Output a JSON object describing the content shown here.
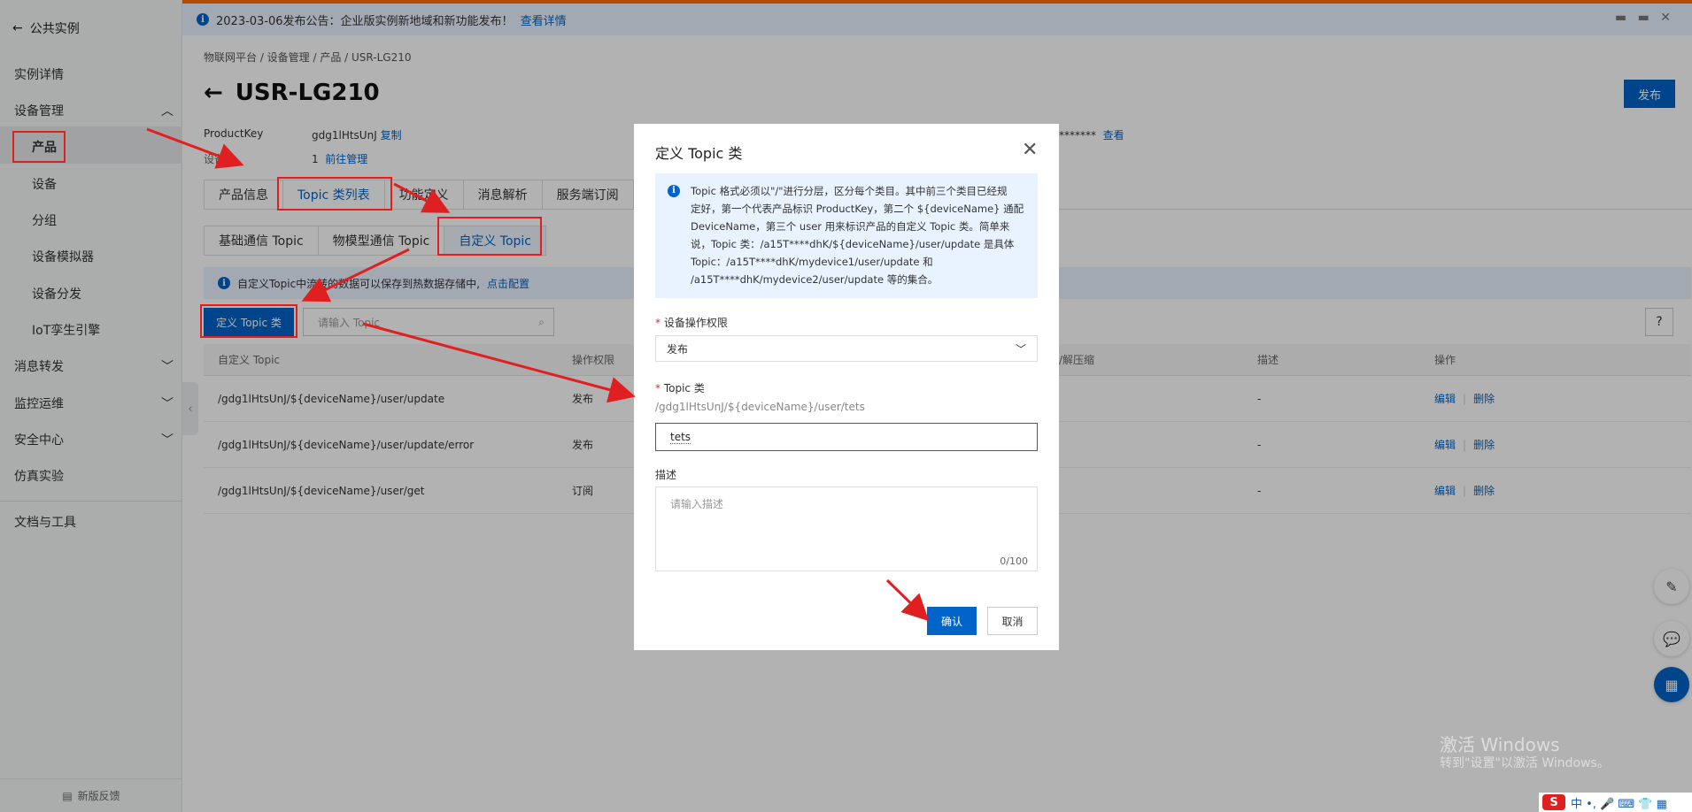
{
  "banner": {
    "text": "2023-03-06发布公告：企业版实例新地域和新功能发布！",
    "link": "查看详情",
    "controls": "▬ ▬ ✕"
  },
  "sidebar": {
    "back_label": "公共实例",
    "items": [
      {
        "label": "实例详情"
      },
      {
        "label": "设备管理"
      },
      {
        "label": "产品"
      },
      {
        "label": "设备"
      },
      {
        "label": "分组"
      },
      {
        "label": "设备模拟器"
      },
      {
        "label": "设备分发"
      },
      {
        "label": "IoT孪生引擎"
      },
      {
        "label": "消息转发"
      },
      {
        "label": "监控运维"
      },
      {
        "label": "安全中心"
      },
      {
        "label": "仿真实验"
      },
      {
        "label": "文档与工具"
      }
    ],
    "feedback": "新版反馈"
  },
  "breadcrumb": "物联网平台  /  设备管理  /  产品  /  USR-LG210",
  "page_title": "USR-LG210",
  "publish_label": "发布",
  "meta": {
    "productkey_label": "ProductKey",
    "productkey_value": "gdg1lHtsUnJ",
    "copy": "复制",
    "device_label": "设备数",
    "device_count": "1",
    "manage_link": "前往管理",
    "secret_mask": "*******",
    "view_link": "查看"
  },
  "tabs": [
    "产品信息",
    "Topic 类列表",
    "功能定义",
    "消息解析",
    "服务端订阅"
  ],
  "subtabs": [
    "基础通信 Topic",
    "物模型通信 Topic",
    "自定义 Topic"
  ],
  "notice": {
    "text": "自定义Topic中流转的数据可以保存到热数据存储中,",
    "link": "点击配置"
  },
  "define_button": "定义 Topic 类",
  "search_placeholder": "请输入 Topic",
  "help": "?",
  "table": {
    "headers": [
      "自定义 Topic",
      "操作权限",
      "/解压缩",
      "描述",
      "操作"
    ],
    "rows": [
      {
        "topic": "/gdg1lHtsUnJ/${deviceName}/user/update",
        "perm": "发布",
        "desc": "-"
      },
      {
        "topic": "/gdg1lHtsUnJ/${deviceName}/user/update/error",
        "perm": "发布",
        "desc": "-"
      },
      {
        "topic": "/gdg1lHtsUnJ/${deviceName}/user/get",
        "perm": "订阅",
        "desc": "-"
      }
    ],
    "edit": "编辑",
    "delete": "删除"
  },
  "modal": {
    "title": "定义 Topic 类",
    "info_lines": [
      "Topic 格式必须以\"/\"进行分层，区分每个类目。其中前三个类目已经规",
      "定好，第一个代表产品标识 ProductKey，第二个 ${deviceName} 通配",
      "DeviceName，第三个 user 用来标识产品的自定义 Topic 类。简单来",
      "说，Topic 类：/a15T****dhK/${deviceName}/user/update 是具体",
      "Topic：/a15T****dhK/mydevice1/user/update 和",
      "/a15T****dhK/mydevice2/user/update 等的集合。"
    ],
    "perm_label": "设备操作权限",
    "perm_value": "发布",
    "topic_label": "Topic 类",
    "topic_path": "/gdg1lHtsUnJ/${deviceName}/user/tets",
    "topic_value": "tets",
    "desc_label": "描述",
    "desc_placeholder": "请输入描述",
    "desc_count": "0/100",
    "ok": "确认",
    "cancel": "取消"
  },
  "watermark": {
    "line1": "激活 Windows",
    "line2": "转到\"设置\"以激活 Windows。"
  },
  "ime": {
    "logo": "S",
    "text": "中 •, 🎤 ⌨ 👕 ▦"
  },
  "colors": {
    "primary": "#0064c8",
    "annotation": "#e02020",
    "brand_orange": "#ff6a00"
  }
}
